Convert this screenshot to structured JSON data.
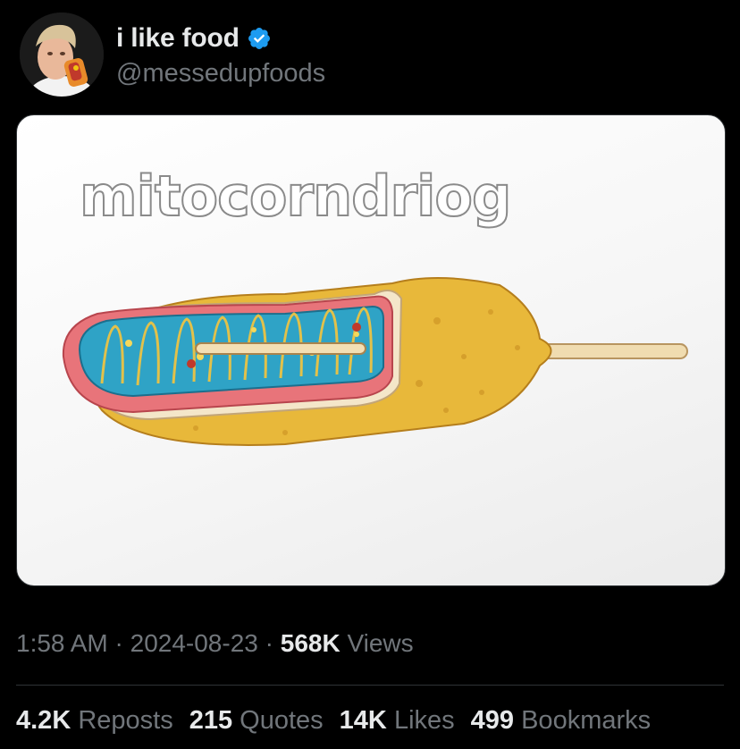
{
  "author": {
    "display_name": "i like food",
    "handle": "@messedupfoods",
    "verified_icon": "verified-badge-icon",
    "badge_color": "#1d9bf0"
  },
  "media": {
    "caption": "mitocorndriog"
  },
  "meta": {
    "time": "1:58 AM",
    "date": "2024-08-23",
    "views_count": "568K",
    "views_label": "Views",
    "separator": "·"
  },
  "stats": {
    "reposts": {
      "count": "4.2K",
      "label": "Reposts"
    },
    "quotes": {
      "count": "215",
      "label": "Quotes"
    },
    "likes": {
      "count": "14K",
      "label": "Likes"
    },
    "bookmarks": {
      "count": "499",
      "label": "Bookmarks"
    }
  },
  "colors": {
    "background": "#000000",
    "primary_text": "#e7e9ea",
    "secondary_text": "#71767b",
    "divider": "#2f3336"
  }
}
